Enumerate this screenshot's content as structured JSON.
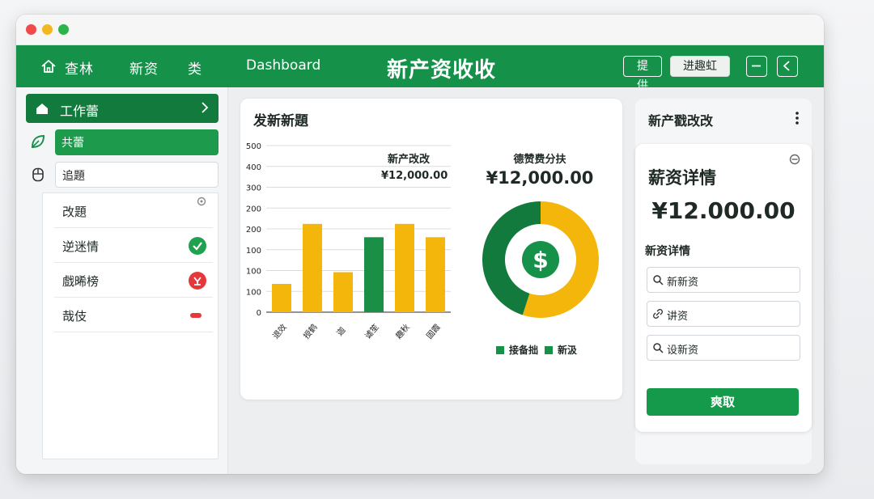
{
  "colors": {
    "brand_green": "#16914a",
    "dark_green": "#117a3c",
    "accent_yellow": "#f4b60b",
    "danger": "#e5383b"
  },
  "navbar": {
    "items": [
      "查林",
      "新资",
      "类"
    ],
    "dashboard": "Dashboard",
    "title": "新产资收收",
    "btn_outline": "提供",
    "btn_light": "进趣虹",
    "icons": [
      "home-icon",
      "minimize-icon",
      "back-icon"
    ]
  },
  "sidebar": {
    "head_label": "工作蕾",
    "active_label": "共蕾",
    "plain_label": "追題",
    "list": [
      {
        "label": "改題",
        "status": "none"
      },
      {
        "label": "逆迷情",
        "status": "ok"
      },
      {
        "label": "戲晞榜",
        "status": "error"
      },
      {
        "label": "哉伎",
        "status": "minus"
      }
    ]
  },
  "main": {
    "title": "发新新題",
    "chart_annotation_title": "新产改改",
    "chart_annotation_value": "¥12,000.00",
    "donut_title": "德赞费分扶",
    "donut_value": "¥12,000.00",
    "legend": [
      "接备拙",
      "新汲"
    ]
  },
  "chart_data": [
    {
      "type": "bar",
      "categories": [
        "退效",
        "授鹤",
        "迦",
        "谑笙",
        "趣秋",
        "固霞"
      ],
      "series": [
        {
          "values": [
            85,
            265,
            120,
            0,
            265,
            225
          ],
          "color": "#f4b60b"
        },
        {
          "values": [
            0,
            0,
            0,
            225,
            0,
            0
          ],
          "color": "#1a8f46"
        }
      ],
      "ytick_labels": [
        "0",
        "100",
        "100",
        "100",
        "200",
        "200",
        "300",
        "400",
        "500"
      ],
      "ylim": [
        0,
        500
      ],
      "grid": true
    },
    {
      "type": "pie",
      "donut": true,
      "slices": [
        {
          "value": 55,
          "color": "#f4b60b"
        },
        {
          "value": 45,
          "color": "#117a3c"
        }
      ],
      "center_icon": "dollar-icon"
    }
  ],
  "right": {
    "head": "新产戳改改",
    "detail_title": "薪资详情",
    "amount": "¥12.000.00",
    "sub": "新资详情",
    "fields": [
      {
        "label": "新新资",
        "icon": "search-icon"
      },
      {
        "label": "讲资",
        "icon": "link-icon"
      },
      {
        "label": "设新资",
        "icon": "search-icon"
      }
    ],
    "submit": "爽取"
  }
}
